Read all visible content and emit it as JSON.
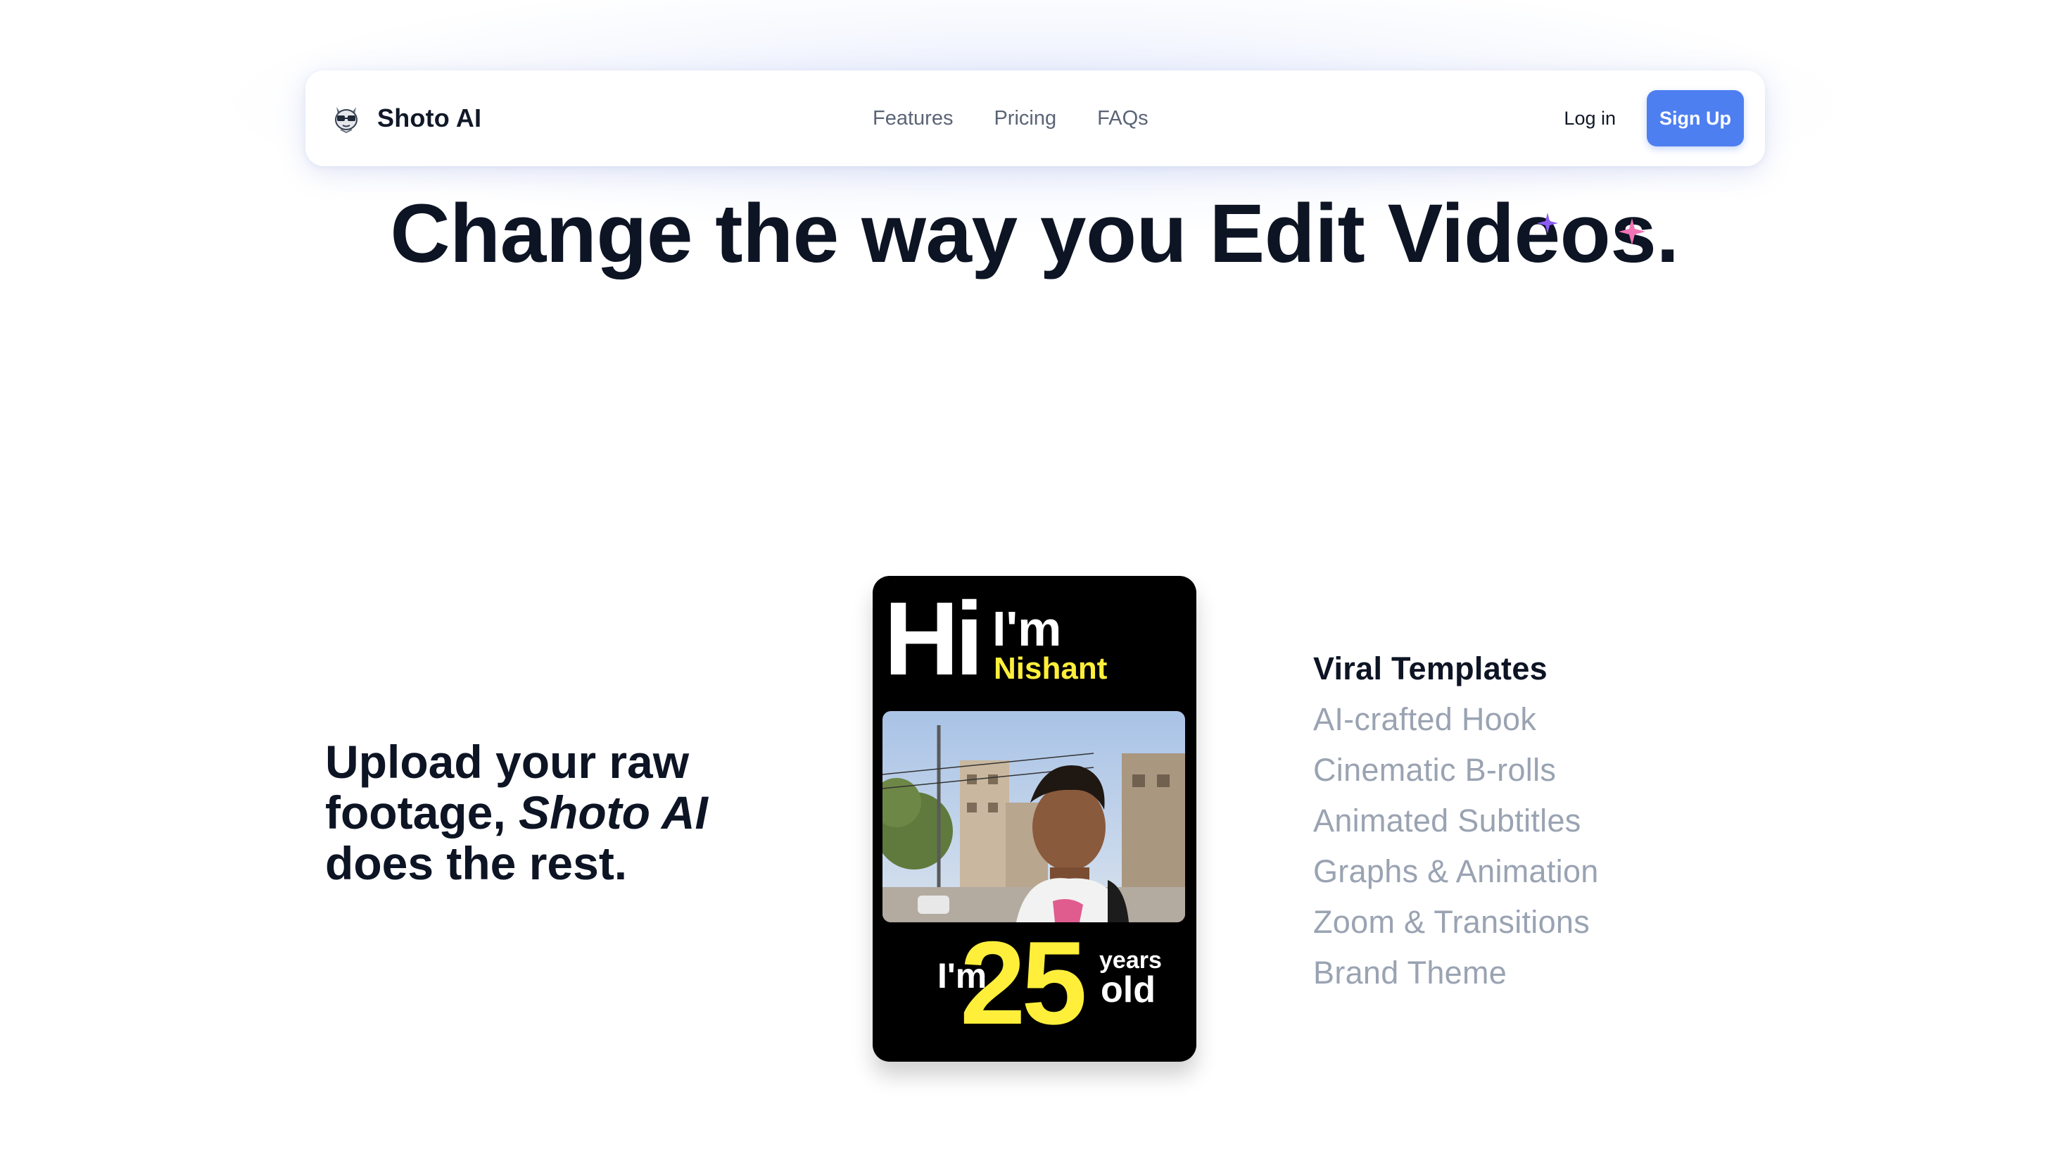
{
  "navbar": {
    "brand": "Shoto AI",
    "links": [
      "Features",
      "Pricing",
      "FAQs"
    ],
    "login_label": "Log in",
    "signup_label": "Sign Up"
  },
  "hero": {
    "title": "Change the way you Edit Videos."
  },
  "tagline": {
    "line1": "Upload your raw",
    "line2_prefix": "footage, ",
    "line2_brand": "Shoto AI",
    "line3": "does the rest."
  },
  "preview_card": {
    "hi": "Hi",
    "im_top": "I'm",
    "name": "Nishant",
    "im_bottom": "I'm",
    "age": "25",
    "years": "years",
    "old": "old"
  },
  "features": {
    "items": [
      "Viral Templates",
      "AI-crafted Hook",
      "Cinematic B-rolls",
      "Animated Subtitles",
      "Graphs & Animation",
      "Zoom & Transitions",
      "Brand Theme"
    ],
    "active_index": 0
  },
  "colors": {
    "accent": "#4e7ff0",
    "heading": "#0d1424",
    "muted": "#9aa3b2",
    "highlight_yellow": "#ffef3a",
    "sparkle_purple": "#8b5cf6",
    "sparkle_pink": "#f472b6"
  },
  "icons": {
    "logo": "mascot-logo-icon",
    "sparkle_small": "sparkle-icon",
    "sparkle_large": "sparkle-icon"
  }
}
